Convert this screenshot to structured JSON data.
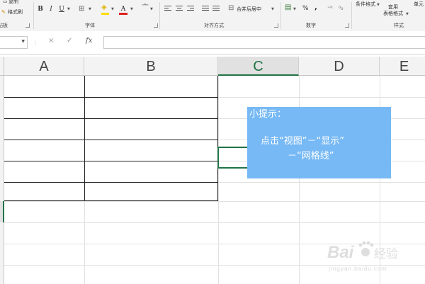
{
  "ribbon": {
    "clipboard": {
      "copy_label": "复制",
      "format_painter_label": "格式刷",
      "group_label": "剪贴板"
    },
    "font": {
      "bold": "B",
      "italic": "I",
      "underline": "U",
      "font_color_glyph": "A",
      "group_label": "字体"
    },
    "alignment": {
      "merge_center_label": "合并后居中",
      "group_label": "对齐方式"
    },
    "number": {
      "percent": "%",
      "comma": ",",
      "group_label": "数字"
    },
    "styles": {
      "conditional_format_label": "条件格式",
      "table_format_line1": "套用",
      "table_format_line2": "表格格式",
      "cell_styles_label": "单元",
      "group_label": "样式"
    }
  },
  "formula_bar": {
    "cancel_glyph": "×",
    "confirm_glyph": "✓",
    "fx_label": "fx"
  },
  "columns": [
    "A",
    "B",
    "C",
    "D",
    "E"
  ],
  "selected_column": "C",
  "tip": {
    "title": "小提示：",
    "line1": "点击“视图”－“显示”",
    "line2": "－“网格线”"
  },
  "watermark": {
    "brand": "Bai",
    "brand_suffix": "经验",
    "site": "jingyan.baidu.com"
  },
  "colors": {
    "accent": "#217346",
    "tip_background": "#77b9f5"
  }
}
